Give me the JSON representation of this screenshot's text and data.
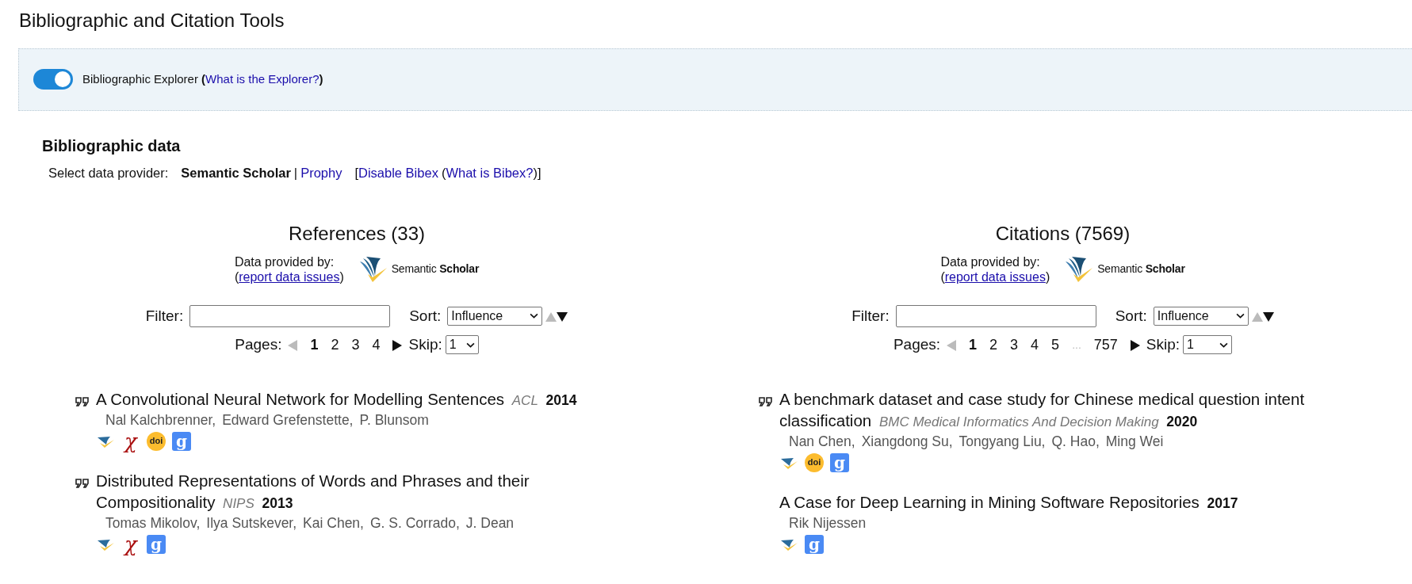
{
  "title": "Bibliographic and Citation Tools",
  "explorer": {
    "on": true,
    "label": "Bibliographic Explorer",
    "paren_open": "(",
    "link": "What is the Explorer?",
    "paren_close": ")"
  },
  "section_title": "Bibliographic data",
  "provider": {
    "label": "Select data provider:",
    "options": [
      {
        "text": "Semantic Scholar",
        "selected": true
      },
      {
        "text": "Prophy",
        "selected": false
      }
    ],
    "separator": "|",
    "bracket_open": "[",
    "disable_link": "Disable Bibex",
    "paren_open": "(",
    "what_link": "What is Bibex?",
    "close": ")]"
  },
  "columns": [
    {
      "heading": "References (33)",
      "provided_by": "Data provided by:",
      "paren_open": "(",
      "report_link": "report data issues",
      "paren_close": ")",
      "logo_text": "Semantic **Scholar**",
      "filter_label": "Filter:",
      "sort_label": "Sort:",
      "sort_value": "Influence",
      "sort_descending": true,
      "pages_label": "Pages:",
      "prev_disabled": true,
      "next_disabled": false,
      "pages": [
        {
          "text": "1",
          "selected": true
        },
        {
          "text": "2",
          "selected": false
        },
        {
          "text": "3",
          "selected": false
        },
        {
          "text": "4",
          "selected": false
        }
      ],
      "skip_label": "Skip:",
      "skip_value": "1",
      "papers": [
        {
          "cite": true,
          "title": "A Convolutional Neural Network for Modelling Sentences",
          "venue": "ACL",
          "year": "2014",
          "authors": [
            "Nal Kalchbrenner,",
            "Edward Grefenstette,",
            "P. Blunsom"
          ],
          "links": [
            {
              "kind": "semantic"
            },
            {
              "kind": "arxiv",
              "glyph": "χ"
            },
            {
              "kind": "doi",
              "glyph": "doi"
            },
            {
              "kind": "scholar",
              "glyph": "g"
            }
          ]
        },
        {
          "cite": true,
          "title": "Distributed Representations of Words and Phrases and their Compositionality",
          "venue": "NIPS",
          "year": "2013",
          "authors": [
            "Tomas Mikolov,",
            "Ilya Sutskever,",
            "Kai Chen,",
            "G. S. Corrado,",
            "J. Dean"
          ],
          "links": [
            {
              "kind": "semantic"
            },
            {
              "kind": "arxiv",
              "glyph": "χ"
            },
            {
              "kind": "scholar",
              "glyph": "g"
            }
          ]
        }
      ]
    },
    {
      "heading": "Citations (7569)",
      "provided_by": "Data provided by:",
      "paren_open": "(",
      "report_link": "report data issues",
      "paren_close": ")",
      "logo_text": "Semantic **Scholar**",
      "filter_label": "Filter:",
      "sort_label": "Sort:",
      "sort_value": "Influence",
      "sort_descending": true,
      "pages_label": "Pages:",
      "prev_disabled": true,
      "next_disabled": false,
      "pages": [
        {
          "text": "1",
          "selected": true
        },
        {
          "text": "2",
          "selected": false
        },
        {
          "text": "3",
          "selected": false
        },
        {
          "text": "4",
          "selected": false
        },
        {
          "text": "5",
          "selected": false
        },
        {
          "text": "...",
          "kind": "gap"
        },
        {
          "text": "757",
          "selected": false
        }
      ],
      "skip_label": "Skip:",
      "skip_value": "1",
      "papers": [
        {
          "cite": true,
          "title": "A benchmark dataset and case study for Chinese medical question intent classification",
          "venue": "BMC Medical Informatics And Decision Making",
          "year": "2020",
          "authors": [
            "Nan Chen,",
            "Xiangdong Su,",
            "Tongyang Liu,",
            "Q. Hao,",
            "Ming Wei"
          ],
          "links": [
            {
              "kind": "semantic"
            },
            {
              "kind": "doi",
              "glyph": "doi"
            },
            {
              "kind": "scholar",
              "glyph": "g"
            }
          ]
        },
        {
          "cite": false,
          "title": "A Case for Deep Learning in Mining Software Repositories",
          "year": "2017",
          "authors": [
            "Rik Nijessen"
          ],
          "links": [
            {
              "kind": "semantic"
            },
            {
              "kind": "scholar",
              "glyph": "g"
            }
          ]
        }
      ]
    }
  ]
}
